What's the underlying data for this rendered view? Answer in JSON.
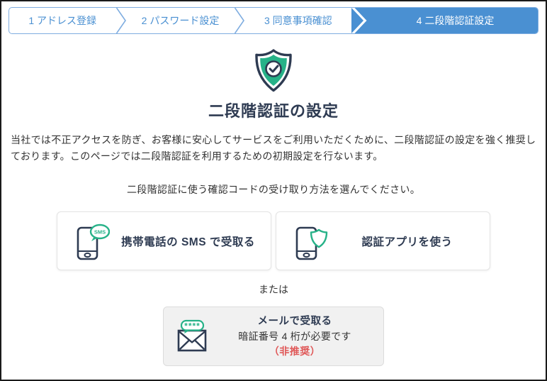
{
  "stepper": {
    "steps": [
      {
        "label": "1 アドレス登録",
        "active": false
      },
      {
        "label": "2 パスワード設定",
        "active": false
      },
      {
        "label": "3 同意事項確認",
        "active": false
      },
      {
        "label": "4 二段階認証設定",
        "active": true
      }
    ]
  },
  "hero": {
    "icon": "shield-check-icon",
    "title": "二段階認証の設定"
  },
  "intro": {
    "text": "当社では不正アクセスを防ぎ、お客様に安心してサービスをご利用いただくために、二段階認証の設定を強く推奨しております。このページでは二段階認証を利用するための初期設定を行ないます。"
  },
  "chooser": {
    "instruction": "二段階認証に使う確認コードの受け取り方法を選んでください。",
    "options": [
      {
        "id": "sms",
        "icon": "phone-sms-icon",
        "label": "携帯電話の SMS で受取る"
      },
      {
        "id": "app",
        "icon": "phone-shield-icon",
        "label": "認証アプリを使う"
      }
    ],
    "or_text": "または",
    "mail_option": {
      "icon": "mail-code-icon",
      "label": "メールで受取る",
      "note": "暗証番号 4 桁が必要です",
      "warning": "（非推奨）"
    }
  },
  "icon_text": {
    "sms_bubble": "SMS",
    "mail_bubble": "****"
  },
  "colors": {
    "accent_blue": "#4a90d2",
    "stepper_border_blue": "#7fade0",
    "brand_green": "#26b288",
    "warning_red": "#e05858",
    "dark_navy": "#2e3b52"
  }
}
